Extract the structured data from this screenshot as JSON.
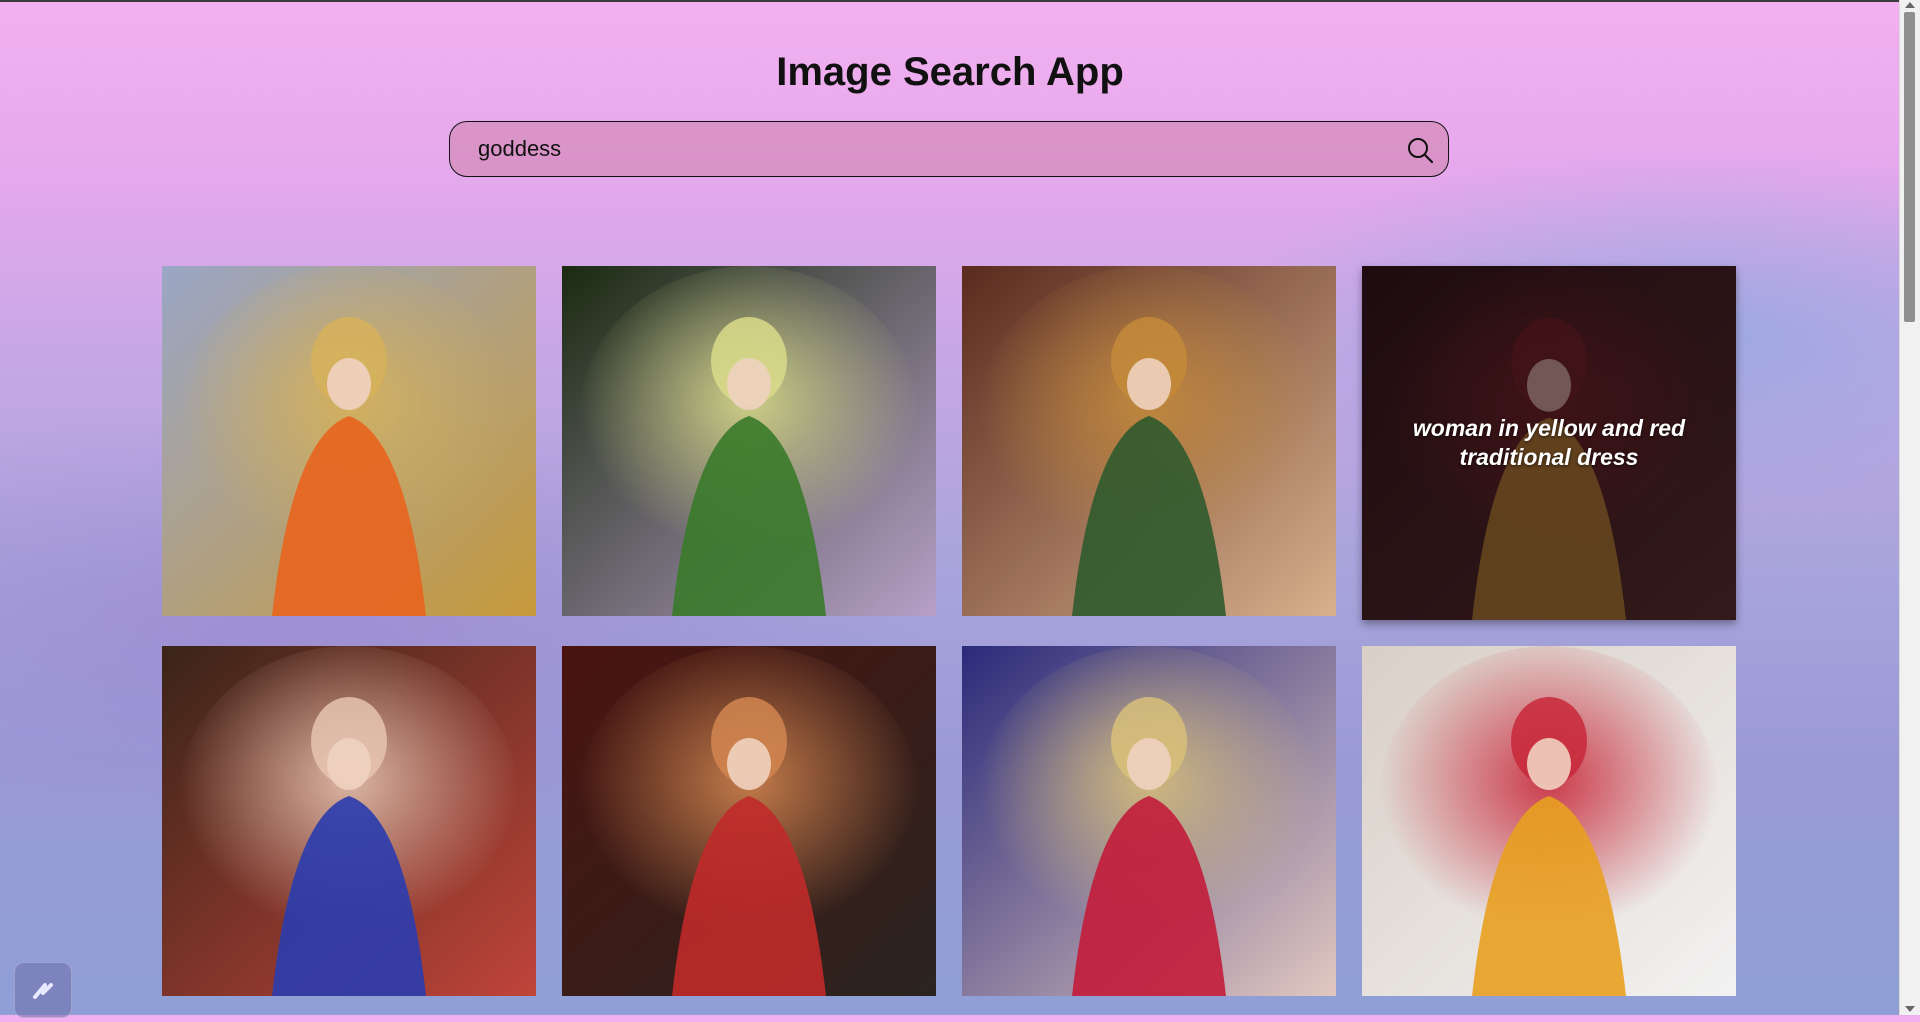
{
  "app": {
    "title": "Image Search App"
  },
  "search": {
    "value": "goddess",
    "placeholder": ""
  },
  "results": [
    {
      "alt": "",
      "palette": [
        "#9aa6c6",
        "#d6b25a",
        "#e8641e",
        "#c79a3a"
      ]
    },
    {
      "alt": "",
      "palette": [
        "#1a2a10",
        "#d9db8a",
        "#3a7a2a",
        "#b7a0c8"
      ]
    },
    {
      "alt": "",
      "palette": [
        "#5a2a1e",
        "#c48a3a",
        "#2f5a2e",
        "#d7b08c"
      ]
    },
    {
      "alt": "woman in yellow and red traditional dress",
      "palette": [
        "#2b1a18",
        "#7a2a28",
        "#c89a3a",
        "#5a3a30"
      ]
    },
    {
      "alt": "",
      "palette": [
        "#3a2418",
        "#e6c3b0",
        "#2a3cae",
        "#c0443a"
      ]
    },
    {
      "alt": "",
      "palette": [
        "#4a1410",
        "#d28650",
        "#c02a2a",
        "#2a2420"
      ]
    },
    {
      "alt": "",
      "palette": [
        "#2a2a7a",
        "#d8c07a",
        "#c21c3a",
        "#e2c8c0"
      ]
    },
    {
      "alt": "",
      "palette": [
        "#d9cfc6",
        "#c8283a",
        "#e8a020",
        "#f2f2f2"
      ]
    }
  ],
  "hover_caption_index": 3
}
